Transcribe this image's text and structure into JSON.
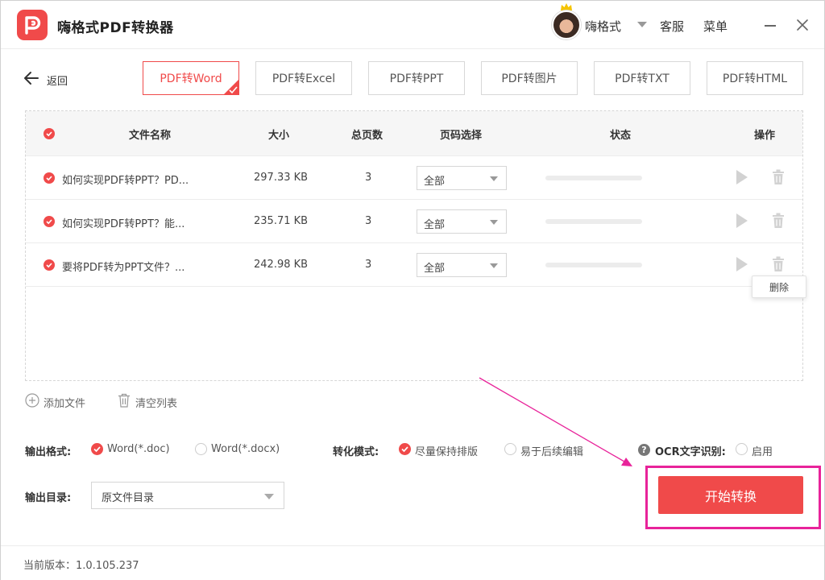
{
  "app": {
    "title": "嗨格式PDF转换器"
  },
  "header": {
    "username": "嗨格式",
    "service": "客服",
    "menu": "菜单"
  },
  "toolbar": {
    "back_label": "返回",
    "tabs": [
      {
        "label": "PDF转Word",
        "active": true
      },
      {
        "label": "PDF转Excel"
      },
      {
        "label": "PDF转PPT"
      },
      {
        "label": "PDF转图片"
      },
      {
        "label": "PDF转TXT"
      },
      {
        "label": "PDF转HTML"
      }
    ]
  },
  "table": {
    "headers": {
      "name": "文件名称",
      "size": "大小",
      "pages": "总页数",
      "page_select": "页码选择",
      "status": "状态",
      "action": "操作"
    },
    "rows": [
      {
        "name": "如何实现PDF转PPT？PD...",
        "size": "297.33 KB",
        "pages": "3",
        "page_select": "全部",
        "progress": 0
      },
      {
        "name": "如何实现PDF转PPT？能...",
        "size": "235.71 KB",
        "pages": "3",
        "page_select": "全部",
        "progress": 0
      },
      {
        "name": "要将PDF转为PPT文件？...",
        "size": "242.98 KB",
        "pages": "3",
        "page_select": "全部",
        "progress": 0
      }
    ],
    "delete_tooltip": "删除"
  },
  "actions": {
    "add_file": "添加文件",
    "clear_list": "清空列表"
  },
  "options": {
    "output_format_label": "输出格式:",
    "format_doc": "Word(*.doc)",
    "format_docx": "Word(*.docx)",
    "selected_format": "doc",
    "mode_label": "转化模式:",
    "mode_keep_layout": "尽量保持排版",
    "mode_easy_edit": "易于后续编辑",
    "selected_mode": "keep_layout",
    "ocr_label": "OCR文字识别:",
    "ocr_enable": "启用",
    "ocr_enabled": false,
    "output_dir_label": "输出目录:",
    "output_dir_value": "原文件目录"
  },
  "start_button": "开始转换",
  "footer": {
    "version": "当前版本：1.0.105.237"
  },
  "colors": {
    "accent": "#f04a4a",
    "highlight": "#e8239a"
  }
}
